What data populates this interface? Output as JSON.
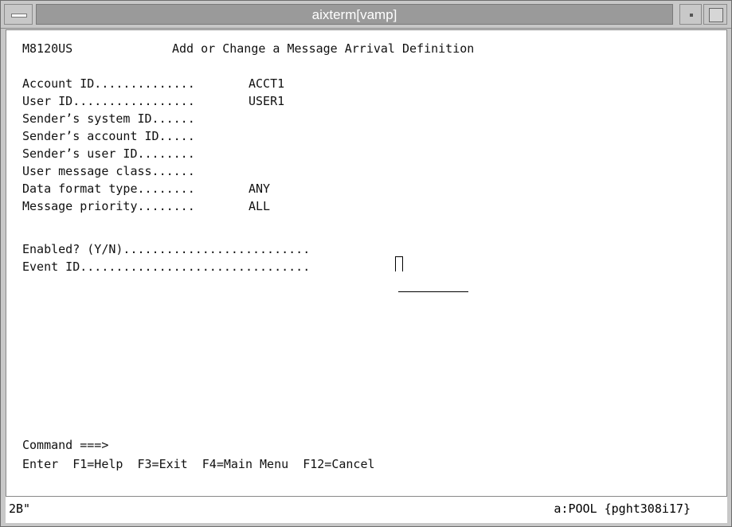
{
  "window": {
    "title": "aixterm[vamp]"
  },
  "screen": {
    "code": "M8120US",
    "title": "Add or Change a Message Arrival Definition",
    "fields": [
      {
        "label": "Account ID..............",
        "value": "ACCT1"
      },
      {
        "label": "User ID.................",
        "value": "USER1"
      },
      {
        "label": "Sender’s system ID......",
        "value": ""
      },
      {
        "label": "Sender’s account ID.....",
        "value": ""
      },
      {
        "label": "Sender’s user ID........",
        "value": ""
      },
      {
        "label": "User message class......",
        "value": ""
      },
      {
        "label": "Data format type........",
        "value": "ANY"
      },
      {
        "label": "Message priority........",
        "value": "ALL"
      }
    ],
    "enabled_label": "Enabled? (Y/N)..........................",
    "enabled_value": "",
    "event_label": "Event ID................................",
    "event_value": "",
    "command_prompt": "Command ===>",
    "fkeys": "Enter  F1=Help  F3=Exit  F4=Main Menu  F12=Cancel"
  },
  "status": {
    "left": "2B\"",
    "right": "a:POOL {pght308i17}"
  }
}
